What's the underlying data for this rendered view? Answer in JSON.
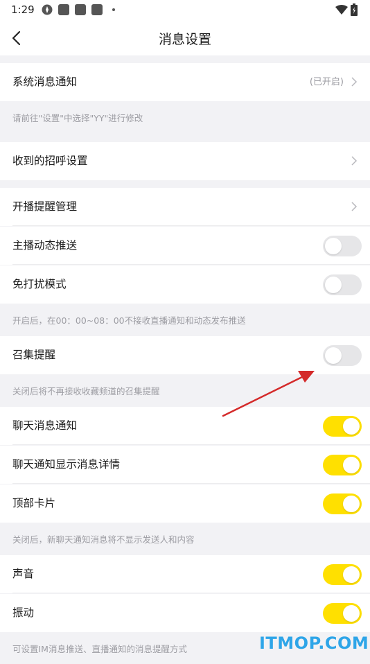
{
  "status_bar": {
    "time": "1:29"
  },
  "header": {
    "title": "消息设置"
  },
  "system_notification": {
    "label": "系统消息通知",
    "value": "(已开启)"
  },
  "hint_system": "请前往\"设置\"中选择\"YY\"进行修改",
  "greeting": {
    "label": "收到的招呼设置"
  },
  "broadcast_reminder": {
    "label": "开播提醒管理"
  },
  "anchor_push": {
    "label": "主播动态推送",
    "on": false
  },
  "dnd_mode": {
    "label": "免打扰模式",
    "on": false
  },
  "hint_dnd": "开启后，在00：00~08：00不接收直播通知和动态发布推送",
  "gather_reminder": {
    "label": "召集提醒",
    "on": false
  },
  "hint_gather": "关闭后将不再接收收藏频道的召集提醒",
  "chat_notification": {
    "label": "聊天消息通知",
    "on": true
  },
  "chat_detail": {
    "label": "聊天通知显示消息详情",
    "on": true
  },
  "top_card": {
    "label": "顶部卡片",
    "on": true
  },
  "hint_chat": "关闭后，新聊天通知消息将不显示发送人和内容",
  "sound": {
    "label": "声音",
    "on": true
  },
  "vibrate": {
    "label": "振动",
    "on": true
  },
  "hint_bottom": "可设置IM消息推送、直播通知的消息提醒方式",
  "watermark": "ITMOP.COM",
  "colors": {
    "accent": "#ffe000",
    "toggle_off": "#e6e6e8",
    "arrow": "#d42a2a",
    "watermark": "#2ea5e8"
  }
}
